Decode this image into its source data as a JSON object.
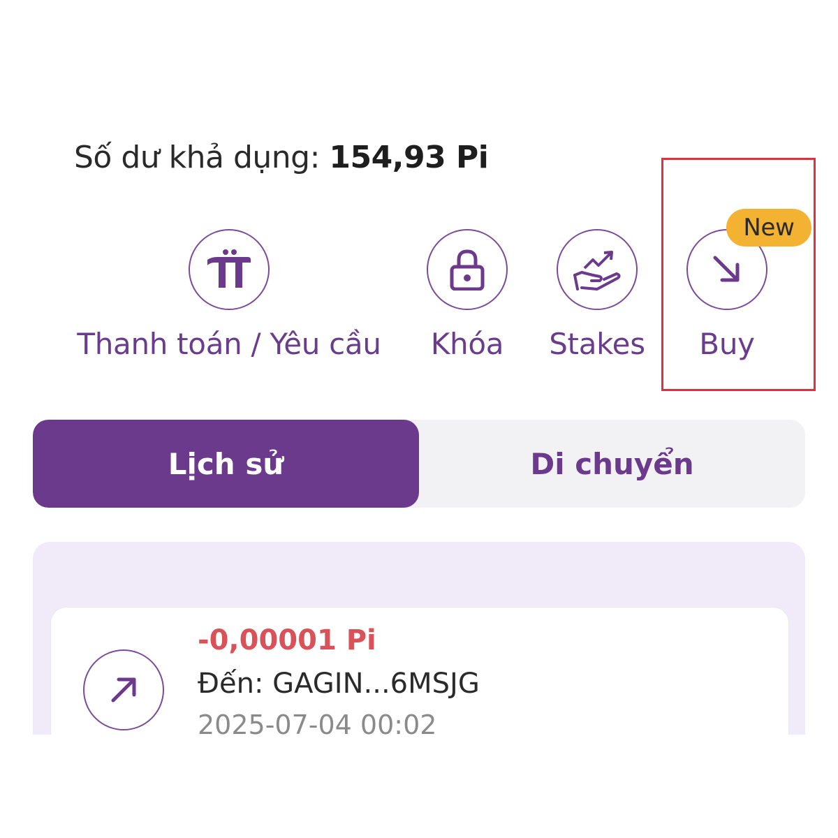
{
  "balance": {
    "label": "Số dư khả dụng: ",
    "amount": "154,93 Pi"
  },
  "actions": [
    {
      "label": "Thanh toán / Yêu cầu",
      "icon": "pi-icon"
    },
    {
      "label": "Khóa",
      "icon": "lock-icon"
    },
    {
      "label": "Stakes",
      "icon": "stake-hand-icon"
    },
    {
      "label": "Buy",
      "icon": "arrow-down-right-icon",
      "badge": "New"
    }
  ],
  "tabs": [
    {
      "label": "Lịch sử",
      "active": true
    },
    {
      "label": "Di chuyển",
      "active": false
    }
  ],
  "transactions": [
    {
      "amount": "-0,00001 Pi",
      "to": "Đến: GAGIN...6MSJG",
      "date": "2025-07-04 00:02",
      "icon": "arrow-up-right-icon"
    }
  ],
  "colors": {
    "accent": "#6c3a8c",
    "negative": "#d9525a",
    "badge": "#f4b233",
    "highlight": "#e0303f"
  }
}
